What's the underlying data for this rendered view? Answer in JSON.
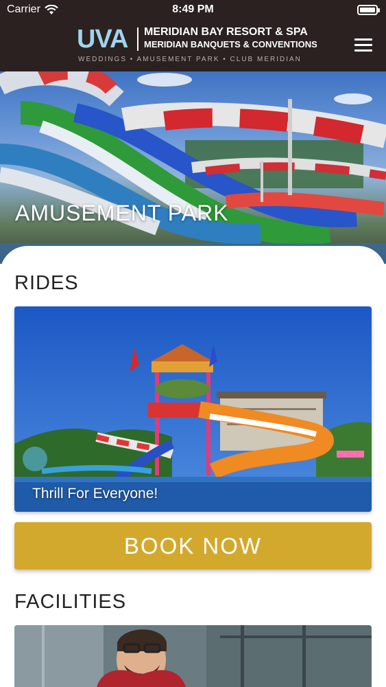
{
  "status_bar": {
    "carrier": "Carrier",
    "time": "8:49 PM",
    "icons": [
      "wifi-icon",
      "battery-icon"
    ]
  },
  "header": {
    "logo_uva": "UVA",
    "logo_line1": "MERIDIAN BAY RESORT & SPA",
    "logo_line2": "MERIDIAN BANQUETS & CONVENTIONS",
    "logo_tagline": "WEDDINGS • AMUSEMENT PARK • CLUB MERIDIAN",
    "menu_icon": "hamburger-menu-icon"
  },
  "hero": {
    "title": "AMUSEMENT PARK"
  },
  "rides": {
    "title": "RIDES",
    "card_caption": "Thrill For Everyone!",
    "book_label": "BOOK NOW"
  },
  "facilities": {
    "title": "FACILITIES"
  },
  "colors": {
    "header_bg": "#2b2121",
    "accent_gold": "#d3a92d",
    "logo_blue": "#9fd4ec"
  }
}
